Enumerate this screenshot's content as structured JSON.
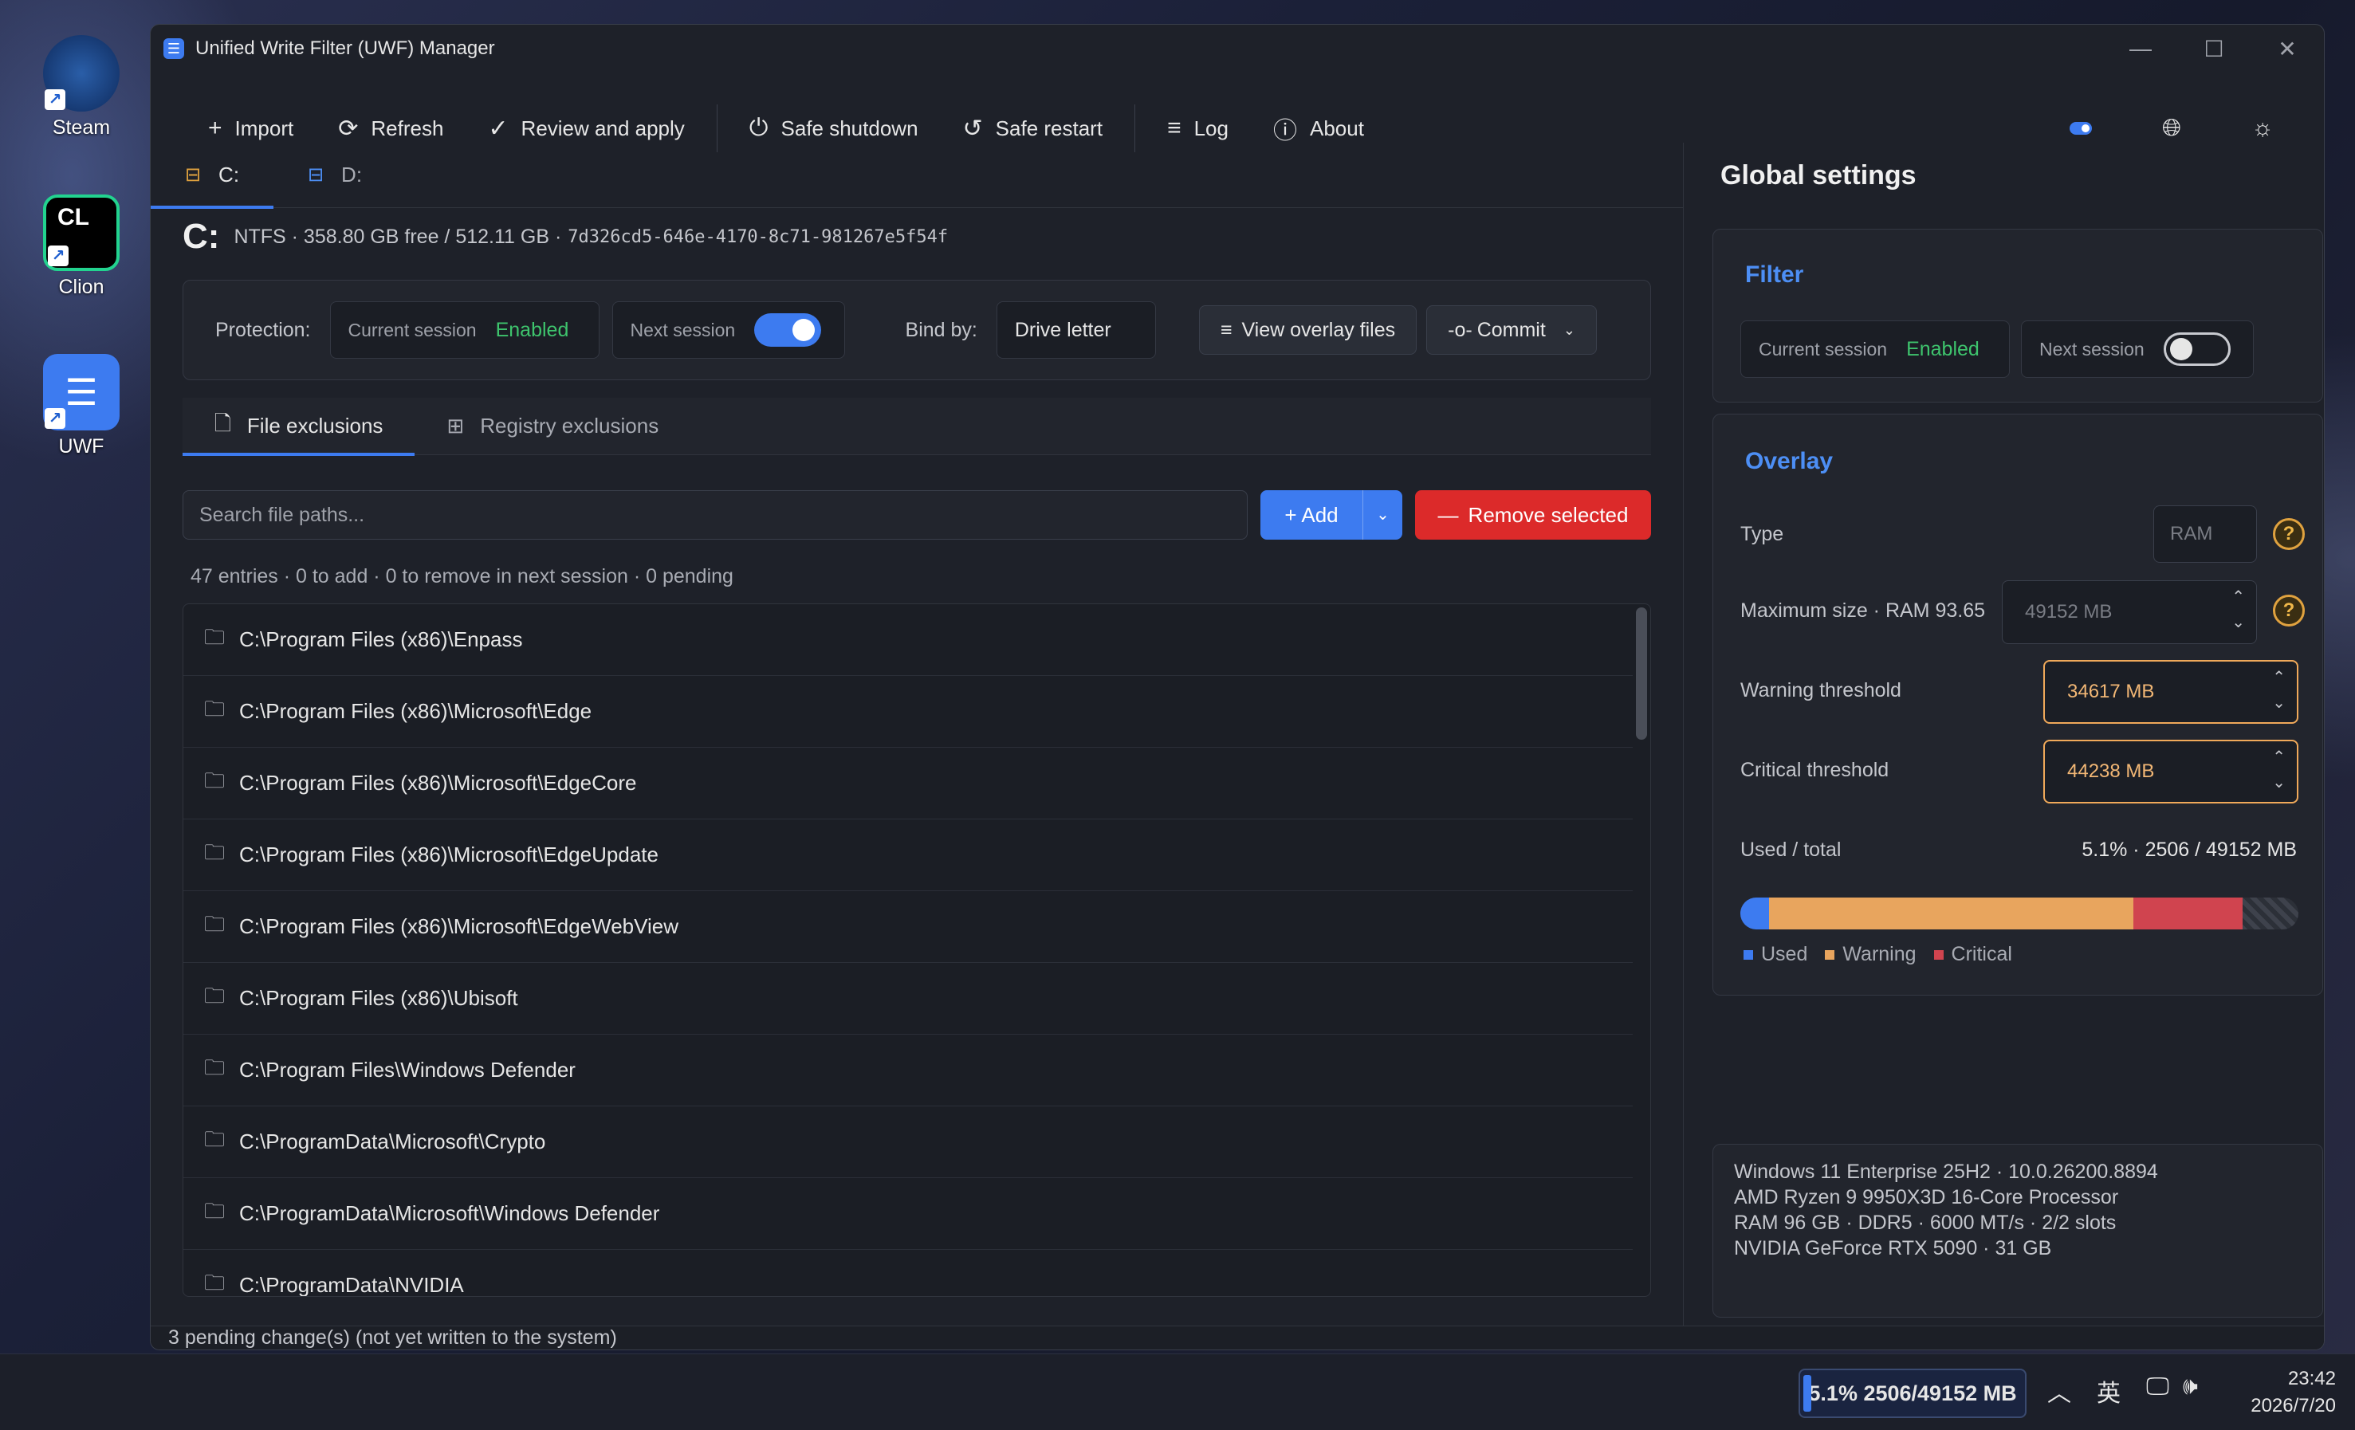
{
  "desktop": {
    "icons": [
      {
        "label": "Steam",
        "bg": "#1a2a4a"
      },
      {
        "label": "Clion",
        "bg": "#000000"
      },
      {
        "label": "UWF",
        "bg": "#3d7bf0"
      }
    ]
  },
  "window": {
    "title": "Unified Write Filter (UWF) Manager"
  },
  "toolbar": {
    "import": "Import",
    "refresh": "Refresh",
    "review": "Review and apply",
    "shutdown": "Safe shutdown",
    "restart": "Safe restart",
    "log": "Log",
    "about": "About"
  },
  "drives": [
    {
      "label": "C:",
      "active": true
    },
    {
      "label": "D:",
      "active": false
    }
  ],
  "drive_info": {
    "letter": "C:",
    "details": "NTFS · 358.80 GB free / 512.11 GB ·",
    "guid": "7d326cd5-646e-4170-8c71-981267e5f54f"
  },
  "protection": {
    "label": "Protection:",
    "current_label": "Current session",
    "current_value": "Enabled",
    "next_label": "Next session",
    "next_on": true,
    "bind_label": "Bind by:",
    "bind_value": "Drive letter",
    "view_overlay": "View overlay files",
    "commit": "Commit"
  },
  "exclusion_tabs": {
    "file": "File exclusions",
    "registry": "Registry exclusions"
  },
  "search": {
    "placeholder": "Search file paths..."
  },
  "actions": {
    "add": "Add",
    "remove": "Remove selected"
  },
  "summary": "47 entries · 0 to add · 0 to remove in next session · 0 pending",
  "files": [
    "C:\\Program Files (x86)\\Enpass",
    "C:\\Program Files (x86)\\Microsoft\\Edge",
    "C:\\Program Files (x86)\\Microsoft\\EdgeCore",
    "C:\\Program Files (x86)\\Microsoft\\EdgeUpdate",
    "C:\\Program Files (x86)\\Microsoft\\EdgeWebView",
    "C:\\Program Files (x86)\\Ubisoft",
    "C:\\Program Files\\Windows Defender",
    "C:\\ProgramData\\Microsoft\\Crypto",
    "C:\\ProgramData\\Microsoft\\Windows Defender",
    "C:\\ProgramData\\NVIDIA"
  ],
  "global": {
    "title": "Global settings",
    "filter": {
      "title": "Filter",
      "current_label": "Current session",
      "current_value": "Enabled",
      "next_label": "Next session",
      "next_on": false
    },
    "overlay": {
      "title": "Overlay",
      "type_label": "Type",
      "type_value": "RAM",
      "max_label": "Maximum size · RAM 93.65",
      "max_value": "49152 MB",
      "warning_label": "Warning threshold",
      "warning_value": "34617 MB",
      "critical_label": "Critical threshold",
      "critical_value": "44238 MB",
      "used_label": "Used / total",
      "used_value": "5.1% · 2506 / 49152 MB",
      "usage": {
        "used_mb": 2506,
        "warning_mb": 34617,
        "critical_mb": 44238,
        "total_mb": 49152
      },
      "legend": {
        "used": "Used",
        "warning": "Warning",
        "critical": "Critical"
      },
      "colors": {
        "used": "#3d7bf0",
        "warning": "#e8a55e",
        "critical": "#d0444f"
      }
    }
  },
  "sysinfo": [
    "Windows 11 Enterprise 25H2 · 10.0.26200.8894",
    "AMD Ryzen 9 9950X3D 16-Core Processor",
    "RAM 96 GB · DDR5 · 6000 MT/s · 2/2 slots",
    "NVIDIA GeForce RTX 5090 · 31 GB"
  ],
  "status": "3 pending change(s) (not yet written to the system)",
  "taskbar": {
    "usage": "5.1% 2506/49152 MB",
    "ime": "英",
    "time": "23:42",
    "date": "2026/7/20"
  }
}
